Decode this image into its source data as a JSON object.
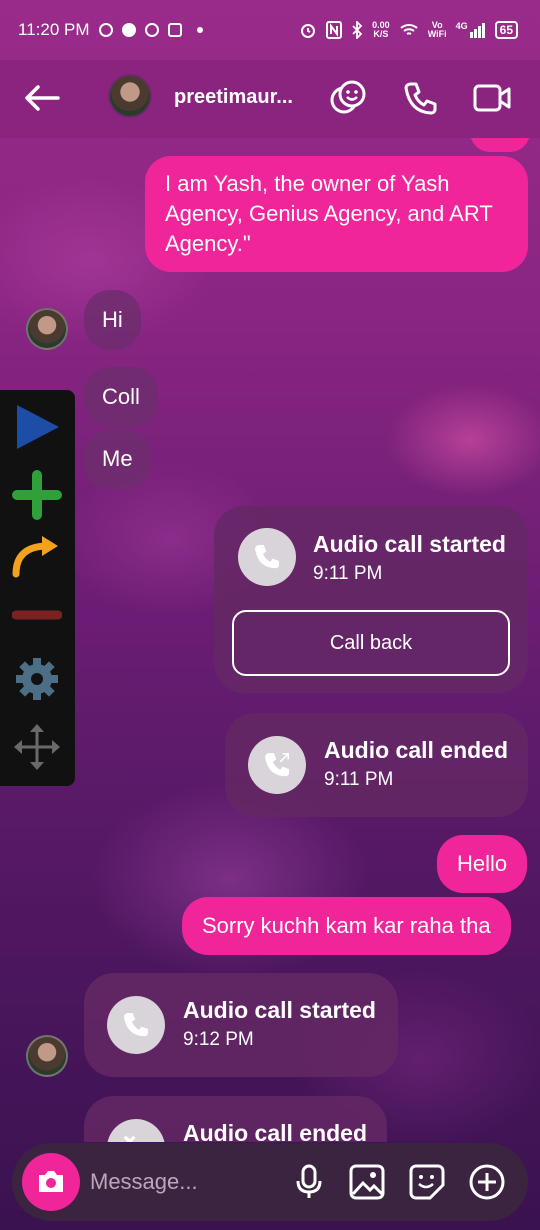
{
  "status_bar": {
    "time": "11:20 PM",
    "speed_top": "0.00",
    "speed_bottom": "K/S",
    "vowifi_top": "Vo",
    "vowifi_bottom": "WiFi",
    "network": "4G",
    "battery": "65"
  },
  "header": {
    "name": "preetimaur..."
  },
  "messages": {
    "out_1": "I am Yash, the owner of Yash Agency, Genius Agency, and ART Agency.\"",
    "in_1": "Hi",
    "in_2": "Coll",
    "in_3": "Me",
    "out_2": "Hello",
    "out_3": "Sorry kuchh kam kar raha tha"
  },
  "calls": [
    {
      "title": "Audio call started",
      "time": "9:11 PM",
      "action": "Call back"
    },
    {
      "title": "Audio call ended",
      "time": "9:11 PM"
    },
    {
      "title": "Audio call started",
      "time": "9:12 PM"
    },
    {
      "title": "Audio call ended"
    }
  ],
  "composer": {
    "placeholder": "Message..."
  },
  "colors": {
    "outgoing_bubble": "#f0259a",
    "header_bg": "#8b247e",
    "incoming_bubble": "#6e2d6e"
  }
}
